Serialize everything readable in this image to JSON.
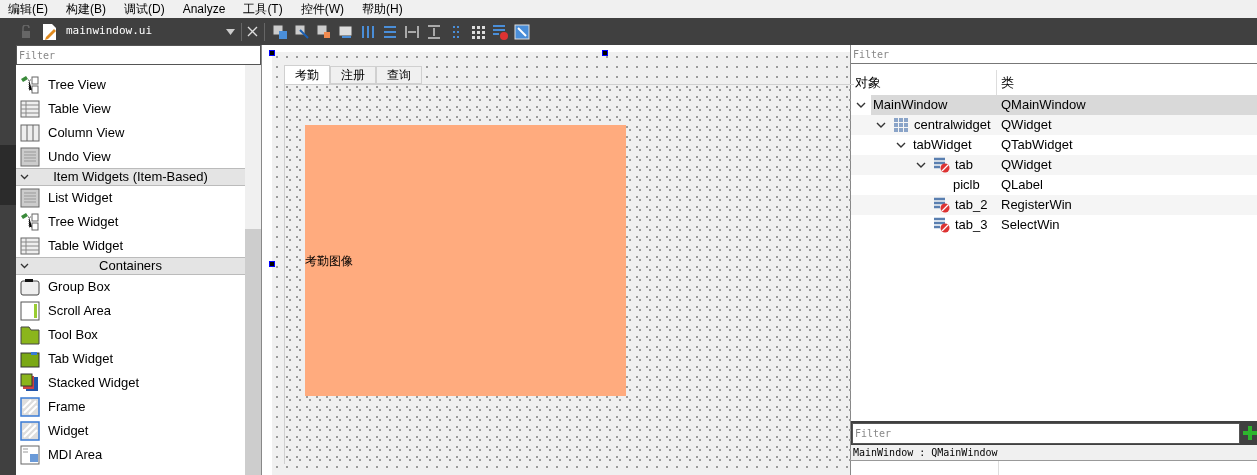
{
  "menu_bar": [
    "编辑(E)",
    "构建(B)",
    "调试(D)",
    "Analyze",
    "工具(T)",
    "控件(W)",
    "帮助(H)"
  ],
  "toolbar": {
    "file_name": "mainwindow.ui"
  },
  "widget_box": {
    "filter_placeholder": "Filter",
    "sections": [
      {
        "items": [
          "Tree View",
          "Table View",
          "Column View",
          "Undo View"
        ]
      },
      {
        "title": "Item Widgets (Item-Based)",
        "expanded": true,
        "items": [
          "List Widget",
          "Tree Widget",
          "Table Widget"
        ]
      },
      {
        "title": "Containers",
        "expanded": true,
        "items": [
          "Group Box",
          "Scroll Area",
          "Tool Box",
          "Tab Widget",
          "Stacked Widget",
          "Frame",
          "Widget",
          "MDI Area"
        ]
      }
    ]
  },
  "form": {
    "tabs": [
      {
        "label": "考勤",
        "selected": true
      },
      {
        "label": "注册",
        "selected": false
      },
      {
        "label": "查询",
        "selected": false
      }
    ],
    "label_text": "考勤图像"
  },
  "object_inspector": {
    "filter_placeholder": "Filter",
    "columns": [
      "对象",
      "类"
    ],
    "tree": [
      {
        "name": "MainWindow",
        "class": "QMainWindow",
        "selected": true,
        "expanded": true,
        "children": [
          {
            "name": "centralwidget",
            "class": "QWidget",
            "selected": false,
            "expanded": true,
            "kind": "grid",
            "children": [
              {
                "name": "tabWidget",
                "class": "QTabWidget",
                "selected": false,
                "expanded": true,
                "children": [
                  {
                    "name": "tab",
                    "class": "QWidget",
                    "selected": false,
                    "expanded": true,
                    "kind": "form",
                    "children": [
                      {
                        "name": "piclb",
                        "class": "QLabel",
                        "selected": false
                      }
                    ]
                  },
                  {
                    "name": "tab_2",
                    "class": "RegisterWin",
                    "selected": false,
                    "kind": "form"
                  },
                  {
                    "name": "tab_3",
                    "class": "SelectWin",
                    "selected": false,
                    "kind": "form"
                  }
                ]
              }
            ]
          }
        ]
      }
    ]
  },
  "property_editor": {
    "filter_placeholder": "Filter",
    "object_label": "MainWindow : QMainWindow"
  }
}
